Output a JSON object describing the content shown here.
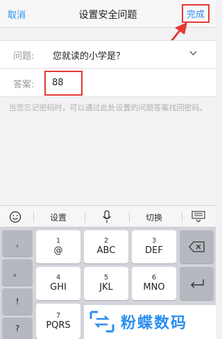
{
  "header": {
    "cancel_label": "取消",
    "title": "设置安全问题",
    "done_label": "完成"
  },
  "form": {
    "question_label": "问题:",
    "question_value": "您就读的小学是？",
    "answer_label": "答案:",
    "answer_value": "88"
  },
  "hint": "当您忘记密码时，可以通过此处设置的问题答案找回密码。",
  "keyboard": {
    "toolbar": {
      "settings_label": "设置",
      "switch_label": "切换"
    },
    "left_column": [
      ",",
      "。",
      "!",
      "?"
    ],
    "keys": [
      {
        "num": "1",
        "letters": "@"
      },
      {
        "num": "2",
        "letters": "ABC"
      },
      {
        "num": "3",
        "letters": "DEF"
      },
      {
        "num": "4",
        "letters": "GHI"
      },
      {
        "num": "5",
        "letters": "JKL"
      },
      {
        "num": "6",
        "letters": "MNO"
      },
      {
        "num": "7",
        "letters": "PQRS"
      }
    ]
  },
  "watermark": "粉蝶数码",
  "colors": {
    "accent": "#2a8ef0",
    "highlight": "#e53935"
  }
}
